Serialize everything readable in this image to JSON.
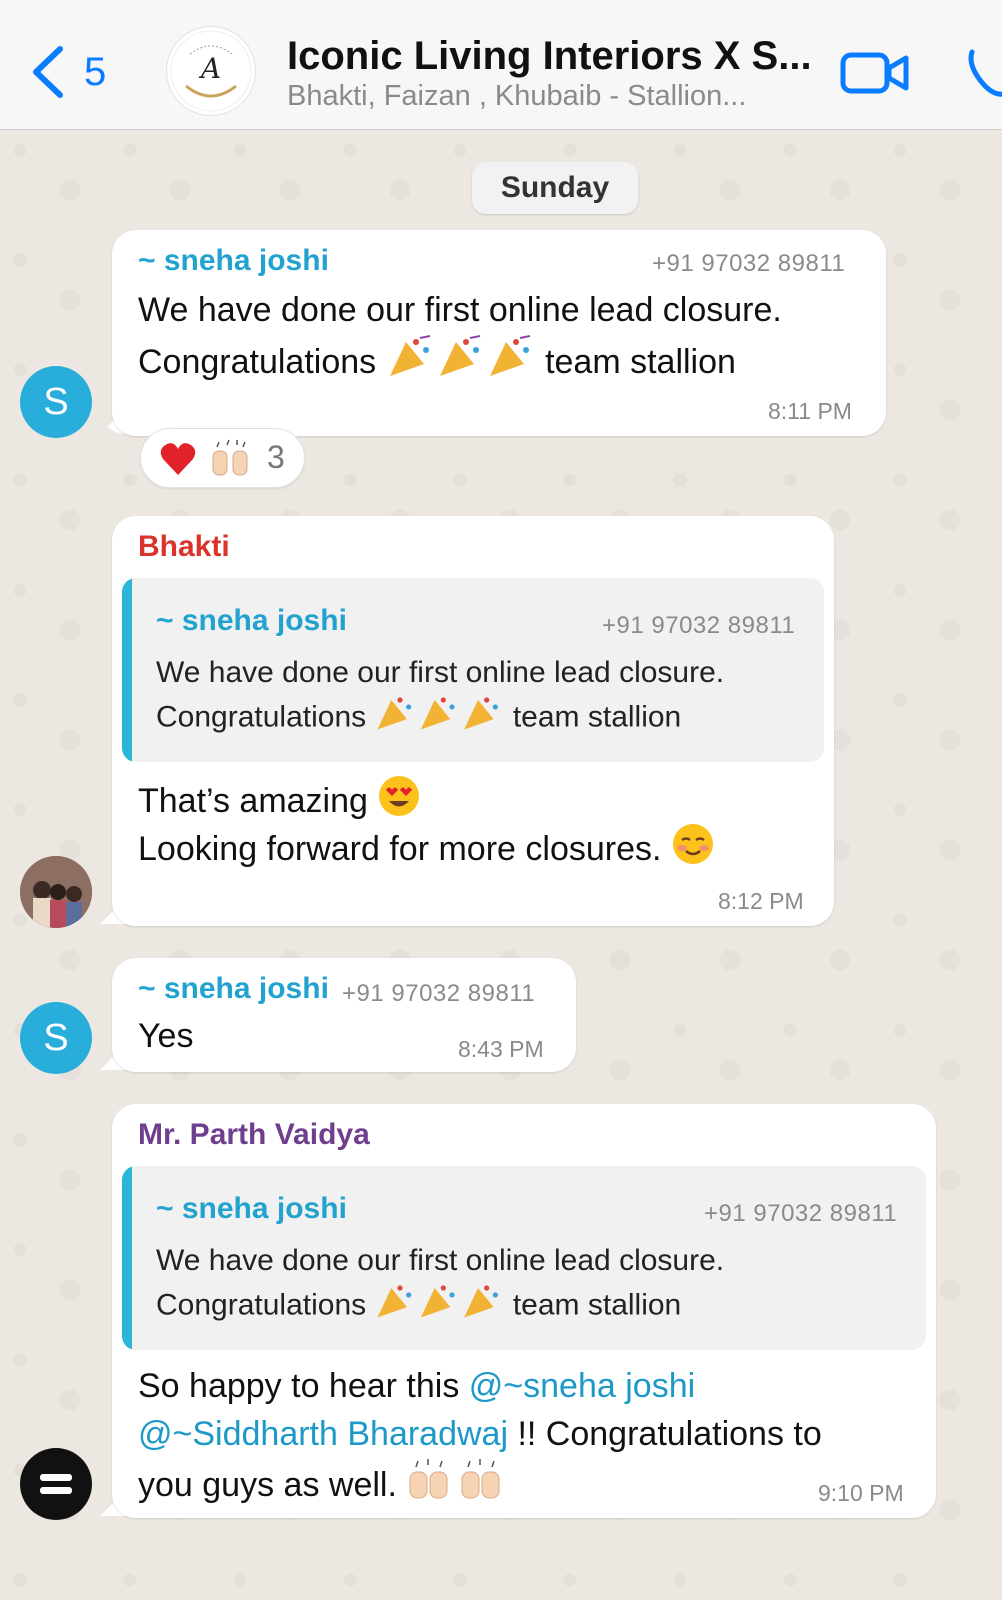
{
  "header": {
    "back_count": "5",
    "title": "Iconic Living Interiors X S...",
    "subtitle": "Bhakti, Faizan , Khubaib - Stallion..."
  },
  "day_label": "Sunday",
  "messages": [
    {
      "sender": "~ sneha joshi",
      "phone": "+91 97032 89811",
      "line1": "We have done our first online lead closure.",
      "line2_a": "Congratulations",
      "line2_b": "team stallion",
      "time": "8:11 PM",
      "avatar_letter": "S",
      "reaction_count": "3"
    },
    {
      "sender": "Bhakti",
      "quote": {
        "sender": "~ sneha joshi",
        "phone": "+91 97032 89811",
        "line1": "We have done our first online lead closure.",
        "line2_a": "Congratulations",
        "line2_b": "team stallion"
      },
      "line1": "That’s amazing",
      "line2": "Looking forward for more closures.",
      "time": "8:12 PM"
    },
    {
      "sender": "~ sneha joshi",
      "phone": "+91 97032 89811",
      "text": "Yes",
      "time": "8:43 PM",
      "avatar_letter": "S"
    },
    {
      "sender": "Mr. Parth Vaidya",
      "quote": {
        "sender": "~ sneha joshi",
        "phone": "+91 97032 89811",
        "line1": "We have done our first online lead closure.",
        "line2_a": "Congratulations",
        "line2_b": "team stallion"
      },
      "line1_a": "So happy to hear this ",
      "mention1": "@~sneha joshi",
      "mention2": "@~Siddharth Bharadwaj",
      "line2_b": " !! Congratulations to",
      "line3": "you guys as well.",
      "time": "9:10 PM"
    }
  ],
  "colors": {
    "accent_blue": "#0a7cff",
    "sneha_name": "#22a3cf",
    "bhakti_name": "#d9342b",
    "parth_name": "#6f3e8f",
    "quote_bar": "#2bb5d8",
    "chat_bg": "#efeae2"
  },
  "icons": [
    "back-chevron-icon",
    "video-call-icon",
    "voice-call-icon",
    "party-popper-emoji",
    "heart-emoji",
    "raised-hands-emoji",
    "heart-eyes-emoji",
    "smiling-blush-emoji"
  ]
}
